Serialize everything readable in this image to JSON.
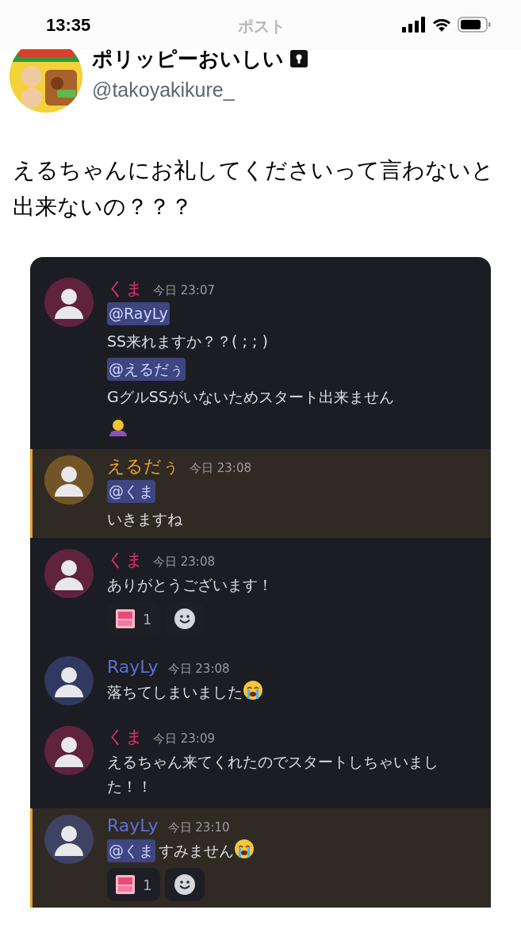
{
  "status_bar": {
    "time": "13:35"
  },
  "header": {
    "title": "ポスト"
  },
  "author": {
    "name": "ポリッピーおいしい",
    "handle": "@takoyakikure_",
    "locked": true
  },
  "tweet_text": "えるちゃんにお礼してくださいって言わないと出来ないの？？？",
  "chat": {
    "messages": [
      {
        "author": "くま",
        "color": "#e0306a",
        "time": "今日 23:07",
        "highlighted": false,
        "paragraphs": [
          [
            {
              "kind": "mention",
              "text": "@RayLy"
            }
          ],
          [
            {
              "kind": "text",
              "text": "SS来れますか？？( ; ; )"
            }
          ],
          [
            {
              "kind": "mention",
              "text": "@えるだぅ"
            }
          ],
          [
            {
              "kind": "text",
              "text": "GグルSSがいないためスタート出来ません"
            }
          ],
          [
            {
              "kind": "bowing-emoji"
            }
          ]
        ]
      },
      {
        "author": "えるだぅ",
        "color": "#f0a22a",
        "time": "今日 23:08",
        "highlighted": true,
        "paragraphs": [
          [
            {
              "kind": "mention",
              "text": "@くま"
            }
          ],
          [
            {
              "kind": "text",
              "text": "いきますね"
            }
          ]
        ]
      },
      {
        "author": "くま",
        "color": "#e0306a",
        "time": "今日 23:08",
        "highlighted": false,
        "paragraphs": [
          [
            {
              "kind": "text",
              "text": "ありがとうございます！"
            }
          ]
        ],
        "reactions": [
          {
            "count": "1"
          }
        ]
      },
      {
        "author": "RayLy",
        "color": "#5a6fd6",
        "time": "今日 23:08",
        "highlighted": false,
        "paragraphs": [
          [
            {
              "kind": "text",
              "text": "落ちてしまいました"
            },
            {
              "kind": "crying-emoji"
            }
          ]
        ]
      },
      {
        "author": "くま",
        "color": "#e0306a",
        "time": "今日 23:09",
        "highlighted": false,
        "paragraphs": [
          [
            {
              "kind": "text",
              "text": "えるちゃん来てくれたのでスタートしちゃいました！！"
            }
          ]
        ]
      },
      {
        "author": "RayLy",
        "color": "#5a6fd6",
        "time": "今日 23:10",
        "highlighted": true,
        "paragraphs": [
          [
            {
              "kind": "mention",
              "text": "@くま"
            },
            {
              "kind": "text",
              "text": "すみません"
            },
            {
              "kind": "crying-emoji"
            }
          ]
        ],
        "reactions": [
          {
            "count": "1"
          }
        ]
      }
    ]
  }
}
